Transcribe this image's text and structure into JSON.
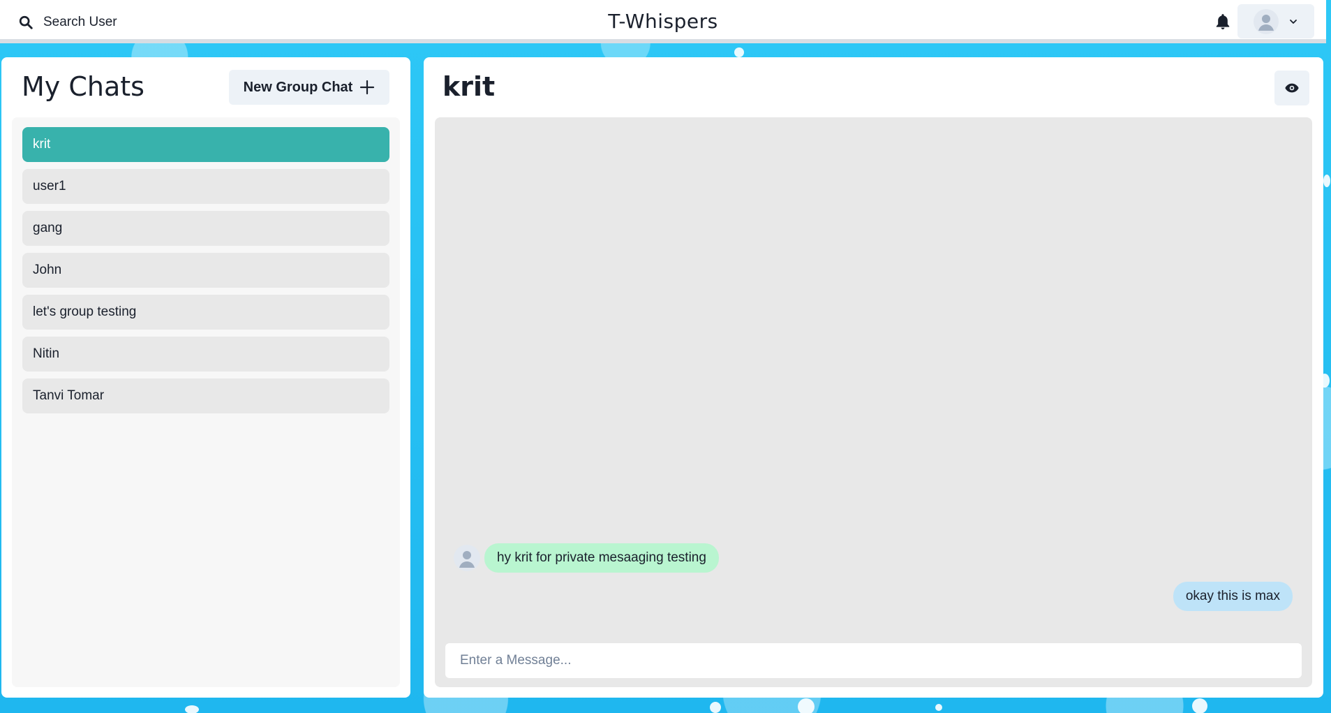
{
  "header": {
    "search_label": "Search User",
    "app_title": "T-Whispers",
    "icons": {
      "search": "search-icon",
      "bell": "bell-icon",
      "avatar": "user-avatar-icon",
      "chevron": "chevron-down-icon"
    }
  },
  "sidebar": {
    "title": "My Chats",
    "new_group_label": "New Group Chat",
    "chats": [
      {
        "label": "krit",
        "active": true
      },
      {
        "label": "user1",
        "active": false
      },
      {
        "label": "gang",
        "active": false
      },
      {
        "label": "John",
        "active": false
      },
      {
        "label": "let's group testing",
        "active": false
      },
      {
        "label": "Nitin",
        "active": false
      },
      {
        "label": "Tanvi Tomar",
        "active": false
      }
    ]
  },
  "chat": {
    "name": "krit",
    "messages": [
      {
        "text": "hy krit for private mesaaging testing",
        "direction": "received"
      },
      {
        "text": "okay this is max",
        "direction": "sent"
      }
    ],
    "input_placeholder": "Enter a Message...",
    "input_value": ""
  },
  "colors": {
    "accent": "#38b2ac",
    "received_bubble": "#b9f5d0",
    "sent_bubble": "#bee3f8",
    "background": "#27c6f5"
  }
}
